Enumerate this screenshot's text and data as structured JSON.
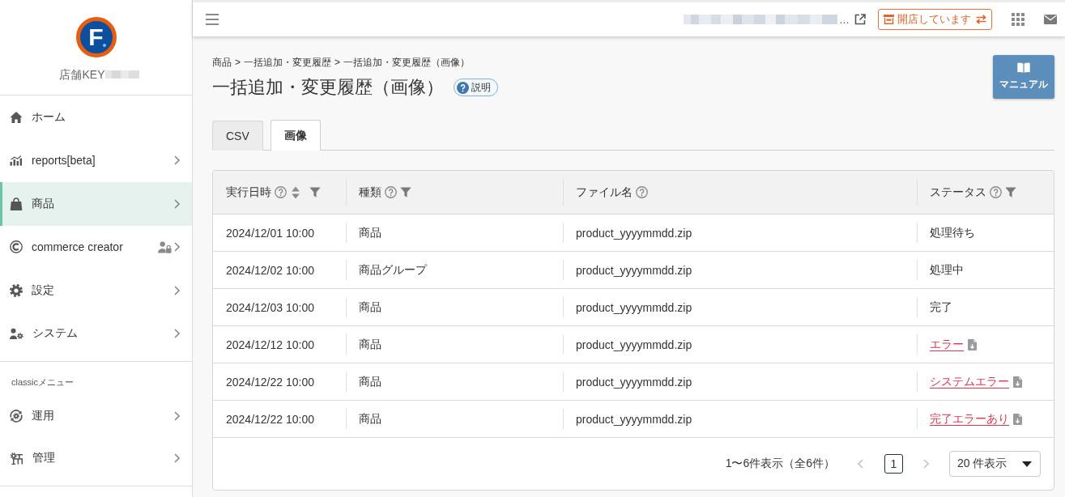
{
  "sidebar": {
    "logo": {
      "letter": "F"
    },
    "store_key_label": "店舗KEY",
    "items": [
      {
        "label": "ホーム",
        "selected": false,
        "expandable": false,
        "locked": false
      },
      {
        "label": "reports[beta]",
        "selected": false,
        "expandable": true,
        "locked": false
      },
      {
        "label": "商品",
        "selected": true,
        "expandable": true,
        "locked": false
      },
      {
        "label": "commerce creator",
        "selected": false,
        "expandable": true,
        "locked": true
      },
      {
        "label": "設定",
        "selected": false,
        "expandable": true,
        "locked": false
      },
      {
        "label": "システム",
        "selected": false,
        "expandable": true,
        "locked": false
      }
    ],
    "classic_menu": {
      "heading": "classicメニュー",
      "items": [
        {
          "label": "運用",
          "selected": false,
          "expandable": true,
          "locked": false
        },
        {
          "label": "管理",
          "selected": false,
          "expandable": true,
          "locked": false
        }
      ]
    }
  },
  "top_bar": {
    "url_suffix": "…",
    "store_status": {
      "label": "開店しています"
    }
  },
  "breadcrumb": [
    {
      "label": "商品",
      "separator": ">"
    },
    {
      "label": "一括追加・変更履歴",
      "separator": ">"
    },
    {
      "label": "一括追加・変更履歴（画像）"
    }
  ],
  "page_title": "一括追加・変更履歴（画像）",
  "help_badge": "説明",
  "manual_button": "マニュアル",
  "tabs": [
    {
      "label": "CSV",
      "selected": false
    },
    {
      "label": "画像",
      "selected": true
    }
  ],
  "table": {
    "columns": [
      {
        "label": "実行日時",
        "help": true,
        "sortable": true,
        "filterable": true
      },
      {
        "label": "種類",
        "help": true,
        "sortable": false,
        "filterable": true
      },
      {
        "label": "ファイル名",
        "help": true,
        "sortable": false,
        "filterable": false
      },
      {
        "label": "ステータス",
        "help": true,
        "sortable": false,
        "filterable": true
      }
    ],
    "rows": [
      {
        "executed_at": "2024/12/01 10:00",
        "type": "商品",
        "file_name": "product_yyyymmdd.zip",
        "status": {
          "label": "処理待ち",
          "kind": "text"
        }
      },
      {
        "executed_at": "2024/12/02 10:00",
        "type": "商品グループ",
        "file_name": "product_yyyymmdd.zip",
        "status": {
          "label": "処理中",
          "kind": "text"
        }
      },
      {
        "executed_at": "2024/12/03 10:00",
        "type": "商品",
        "file_name": "product_yyyymmdd.zip",
        "status": {
          "label": "完了",
          "kind": "text"
        }
      },
      {
        "executed_at": "2024/12/12 10:00",
        "type": "商品",
        "file_name": "product_yyyymmdd.zip",
        "status": {
          "label": "エラー",
          "kind": "error_link"
        }
      },
      {
        "executed_at": "2024/12/22 10:00",
        "type": "商品",
        "file_name": "product_yyyymmdd.zip",
        "status": {
          "label": "システムエラー",
          "kind": "error_link"
        }
      },
      {
        "executed_at": "2024/12/22 10:00",
        "type": "商品",
        "file_name": "product_yyyymmdd.zip",
        "status": {
          "label": "完了エラーあり",
          "kind": "error_link"
        }
      }
    ]
  },
  "pagination": {
    "summary": "1〜6件表示（全6件）",
    "previous": {
      "disabled": true
    },
    "pages": [
      {
        "label": "1",
        "selected": true
      }
    ],
    "next": {
      "disabled": true
    },
    "page_size": "20 件表示"
  }
}
